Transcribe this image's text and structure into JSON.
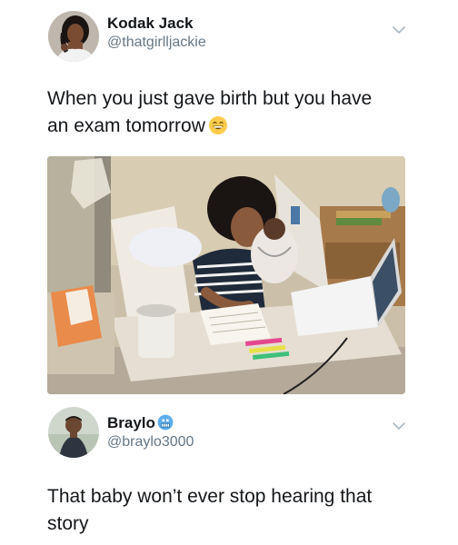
{
  "tweet": {
    "display_name": "Kodak Jack",
    "handle": "@thatgirlljackie",
    "text_line1": "When you just gave birth but you have",
    "text_line2": "an exam tomorrow",
    "emoji": "grinning-face-icon"
  },
  "reply": {
    "display_name": "Braylo",
    "name_emoji": "cold-face-icon",
    "handle": "@braylo3000",
    "text_line1": "That baby won’t ever stop hearing that",
    "text_line2": "story"
  },
  "colors": {
    "text": "#14171a",
    "secondary": "#657786",
    "chevron": "#aab8c2"
  }
}
